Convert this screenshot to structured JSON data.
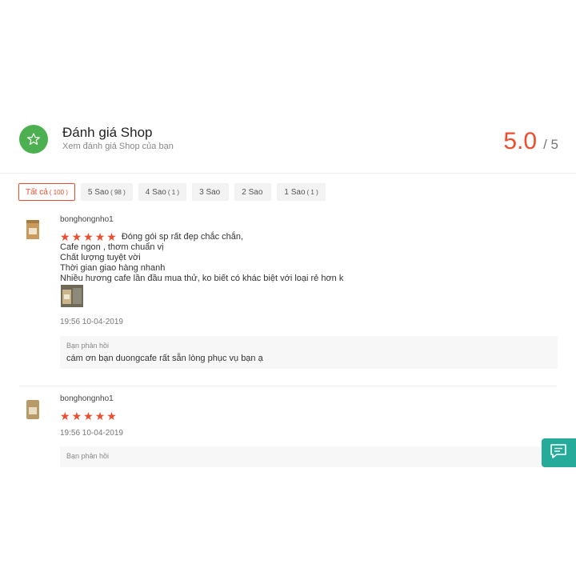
{
  "header": {
    "title": "Đánh giá Shop",
    "subtitle": "Xem đánh giá Shop của bạn",
    "score": "5.0",
    "score_max": "/ 5",
    "icon": "star-outline-icon"
  },
  "filters": [
    {
      "label": "Tất cả",
      "count": "( 100 )",
      "active": true
    },
    {
      "label": "5 Sao",
      "count": "( 98 )"
    },
    {
      "label": "4 Sao",
      "count": "( 1 )"
    },
    {
      "label": "3 Sao",
      "count": ""
    },
    {
      "label": "2 Sao",
      "count": ""
    },
    {
      "label": "1 Sao",
      "count": "( 1 )"
    }
  ],
  "reviews": [
    {
      "username": "bonghongnho1",
      "rating": 5,
      "lines": [
        "Đóng gói sp rất đẹp chắc chắn,",
        "Cafe ngon , thơm chuẩn vị",
        "Chất lượng tuyệt vời",
        "Thời gian giao hàng nhanh",
        "Nhiều hương cafe lần đầu mua thử, ko biết có khác biệt với loại rẻ hơn k"
      ],
      "date": "19:56 10-04-2019",
      "reply_label": "Bạn phản hồi",
      "reply_text": "cám ơn bạn duongcafe rất sẵn lòng phục vụ bạn ạ"
    },
    {
      "username": "bonghongnho1",
      "rating": 5,
      "date": "19:56 10-04-2019",
      "reply_label": "Bạn phản hồi"
    }
  ],
  "chat_button": {
    "icon": "chat-icon"
  },
  "colors": {
    "accent": "#ee4d2d",
    "shop_icon_bg": "#4caf50",
    "chat_bg": "#26aa99"
  }
}
